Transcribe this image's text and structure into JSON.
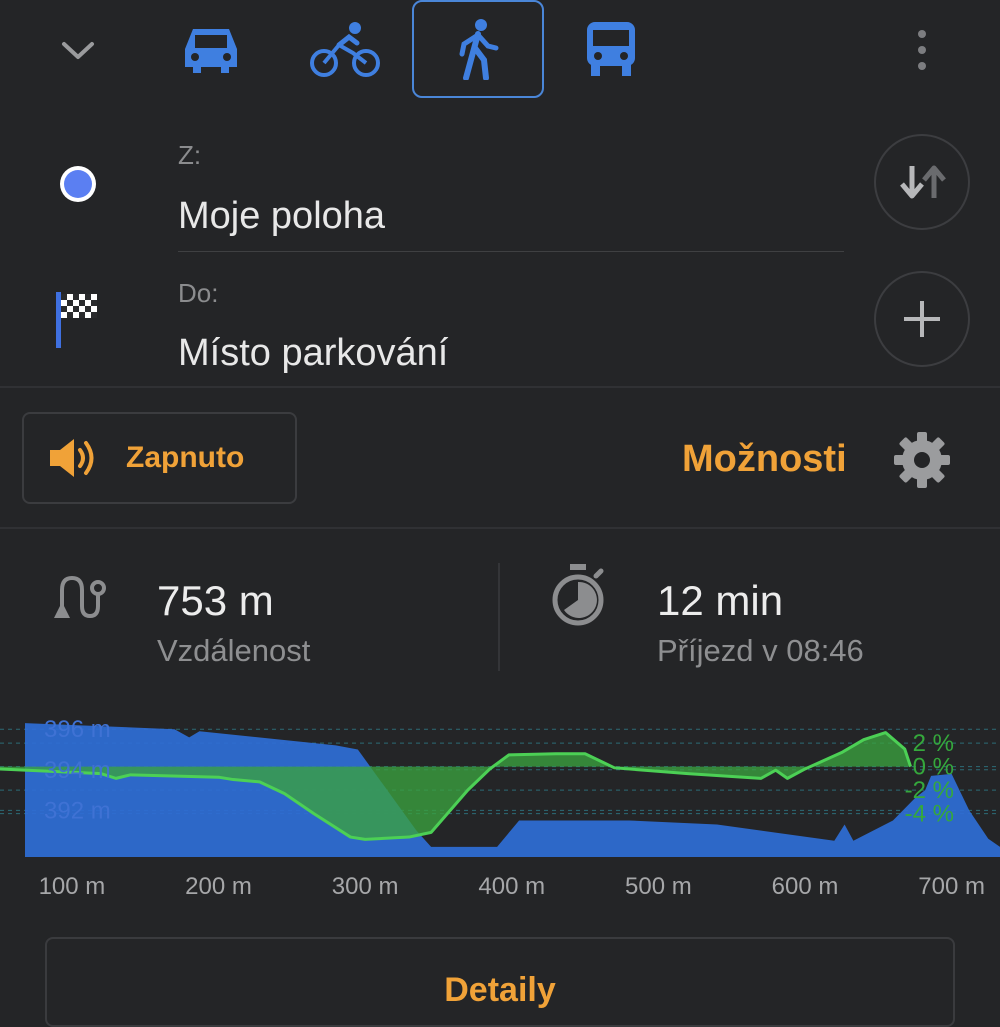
{
  "colors": {
    "background": "#242527",
    "accent_blue": "#4a86d8",
    "accent_orange": "#f0a238",
    "elevation_blue": "#2f6ed6",
    "slope_green": "#3aa13f"
  },
  "header": {
    "modes": [
      {
        "name": "car",
        "icon": "car-icon",
        "active": false
      },
      {
        "name": "bicycle",
        "icon": "bicycle-icon",
        "active": false
      },
      {
        "name": "walk",
        "icon": "walk-icon",
        "active": true
      },
      {
        "name": "bus",
        "icon": "bus-icon",
        "active": false
      }
    ],
    "collapse_icon": "chevron-down-icon",
    "menu_icon": "more-vertical-icon"
  },
  "route": {
    "from_label": "Z:",
    "from_value": "Moje poloha",
    "to_label": "Do:",
    "to_value": "Místo parkování",
    "swap_icon": "swap-arrows-icon",
    "add_icon": "plus-icon"
  },
  "voice": {
    "label": "Zapnuto",
    "icon": "speaker-icon"
  },
  "options": {
    "label": "Možnosti",
    "icon": "gear-icon"
  },
  "stats": {
    "distance_value": "753 m",
    "distance_label": "Vzdálenost",
    "time_value": "12 min",
    "time_label": "Příjezd v 08:46"
  },
  "chart_data": {
    "type": "area",
    "x_tick_labels": [
      "100 m",
      "200 m",
      "300 m",
      "400 m",
      "500 m",
      "600 m",
      "700 m"
    ],
    "x_ticks": [
      100,
      200,
      300,
      400,
      500,
      600,
      700
    ],
    "xlim": [
      68,
      733
    ],
    "y_left_tick_labels": [
      "396 m",
      "394 m",
      "392 m"
    ],
    "y_left_ticks": [
      396,
      394,
      392
    ],
    "ylim_left": [
      389.7,
      396.7
    ],
    "y_right_tick_labels": [
      "2 %",
      "0 %",
      "-2 %",
      "-4 %"
    ],
    "y_right_ticks": [
      2,
      0,
      -2,
      -4
    ],
    "ylim_right": [
      -7.7,
      4.4
    ],
    "grid": "dashed horizontal",
    "series": [
      {
        "name": "elevation",
        "values": [
          [
            68,
            396.3
          ],
          [
            170,
            396.0
          ],
          [
            180,
            395.6
          ],
          [
            187,
            395.9
          ],
          [
            280,
            395.2
          ],
          [
            295,
            395.0
          ],
          [
            335,
            391.0
          ],
          [
            345,
            390.2
          ],
          [
            390,
            390.2
          ],
          [
            405,
            391.5
          ],
          [
            480,
            391.5
          ],
          [
            540,
            391.3
          ],
          [
            620,
            390.5
          ],
          [
            627,
            391.3
          ],
          [
            633,
            390.5
          ],
          [
            660,
            391.5
          ],
          [
            675,
            392.6
          ],
          [
            682,
            393.0
          ],
          [
            686,
            393.7
          ],
          [
            700,
            393.8
          ],
          [
            712,
            392.0
          ],
          [
            725,
            390.6
          ],
          [
            733,
            390.2
          ]
        ]
      },
      {
        "name": "slope",
        "values": [
          [
            50,
            -0.2
          ],
          [
            120,
            -0.6
          ],
          [
            130,
            -1.0
          ],
          [
            140,
            -0.7
          ],
          [
            200,
            -0.9
          ],
          [
            210,
            -1.1
          ],
          [
            228,
            -1.3
          ],
          [
            245,
            -2.3
          ],
          [
            265,
            -4.0
          ],
          [
            290,
            -6.0
          ],
          [
            300,
            -6.2
          ],
          [
            330,
            -6.0
          ],
          [
            345,
            -5.6
          ],
          [
            370,
            -2.0
          ],
          [
            385,
            -0.2
          ],
          [
            398,
            1.0
          ],
          [
            430,
            1.1
          ],
          [
            450,
            1.1
          ],
          [
            470,
            -0.1
          ],
          [
            520,
            -0.6
          ],
          [
            570,
            -1.0
          ],
          [
            580,
            -0.3
          ],
          [
            588,
            -1.0
          ],
          [
            600,
            -0.2
          ],
          [
            625,
            1.2
          ],
          [
            640,
            2.3
          ],
          [
            655,
            2.9
          ],
          [
            668,
            1.5
          ],
          [
            672,
            0.0
          ]
        ]
      }
    ]
  },
  "details": {
    "label": "Detaily"
  }
}
